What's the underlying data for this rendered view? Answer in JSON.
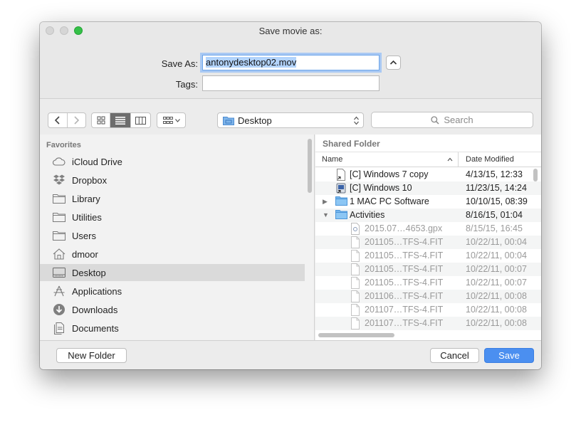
{
  "window": {
    "title": "Save movie as:"
  },
  "form": {
    "save_as_label": "Save As:",
    "save_as_value": "antonydesktop02.mov",
    "tags_label": "Tags:",
    "tags_value": ""
  },
  "toolbar": {
    "location": "Desktop",
    "search_placeholder": "Search",
    "active_view": "list"
  },
  "sidebar": {
    "heading": "Favorites",
    "items": [
      {
        "label": "iCloud Drive",
        "icon": "cloud-icon",
        "selected": false
      },
      {
        "label": "Dropbox",
        "icon": "dropbox-icon",
        "selected": false
      },
      {
        "label": "Library",
        "icon": "folder-icon",
        "selected": false
      },
      {
        "label": "Utilities",
        "icon": "folder-icon",
        "selected": false
      },
      {
        "label": "Users",
        "icon": "folder-icon",
        "selected": false
      },
      {
        "label": "dmoor",
        "icon": "home-icon",
        "selected": false
      },
      {
        "label": "Desktop",
        "icon": "desktop-icon",
        "selected": true
      },
      {
        "label": "Applications",
        "icon": "applications-icon",
        "selected": false
      },
      {
        "label": "Downloads",
        "icon": "downloads-icon",
        "selected": false
      },
      {
        "label": "Documents",
        "icon": "documents-icon",
        "selected": false
      }
    ]
  },
  "browser": {
    "folder_title": "Shared Folder",
    "columns": {
      "name": "Name",
      "date": "Date Modified"
    },
    "rows": [
      {
        "name": "[C] Windows 7 copy",
        "date": "4/13/15, 12:33",
        "icon": "alias-doc-icon",
        "disclosure": "",
        "dim": false,
        "indent": 0
      },
      {
        "name": "[C] Windows 10",
        "date": "11/23/15, 14:24",
        "icon": "alias-app-icon",
        "disclosure": "",
        "dim": false,
        "indent": 0
      },
      {
        "name": "1 MAC PC Software",
        "date": "10/10/15, 08:39",
        "icon": "folder-icon",
        "disclosure": "▶",
        "dim": false,
        "indent": 0
      },
      {
        "name": "Activities",
        "date": "8/16/15, 01:04",
        "icon": "folder-icon",
        "disclosure": "▼",
        "dim": false,
        "indent": 0
      },
      {
        "name": "2015.07…4653.gpx",
        "date": "8/15/15, 16:45",
        "icon": "gpx-file-icon",
        "disclosure": "",
        "dim": true,
        "indent": 1
      },
      {
        "name": "201105…TFS-4.FIT",
        "date": "10/22/11, 00:04",
        "icon": "document-icon",
        "disclosure": "",
        "dim": true,
        "indent": 1
      },
      {
        "name": "201105…TFS-4.FIT",
        "date": "10/22/11, 00:04",
        "icon": "document-icon",
        "disclosure": "",
        "dim": true,
        "indent": 1
      },
      {
        "name": "201105…TFS-4.FIT",
        "date": "10/22/11, 00:07",
        "icon": "document-icon",
        "disclosure": "",
        "dim": true,
        "indent": 1
      },
      {
        "name": "201105…TFS-4.FIT",
        "date": "10/22/11, 00:07",
        "icon": "document-icon",
        "disclosure": "",
        "dim": true,
        "indent": 1
      },
      {
        "name": "201106…TFS-4.FIT",
        "date": "10/22/11, 00:08",
        "icon": "document-icon",
        "disclosure": "",
        "dim": true,
        "indent": 1
      },
      {
        "name": "201107…TFS-4.FIT",
        "date": "10/22/11, 00:08",
        "icon": "document-icon",
        "disclosure": "",
        "dim": true,
        "indent": 1
      },
      {
        "name": "201107…TFS-4.FIT",
        "date": "10/22/11, 00:08",
        "icon": "document-icon",
        "disclosure": "",
        "dim": true,
        "indent": 1
      }
    ]
  },
  "buttons": {
    "new_folder": "New Folder",
    "cancel": "Cancel",
    "save": "Save"
  },
  "colors": {
    "accent": "#4b8ff0",
    "selection": "#b3d4fc",
    "zoom_button": "#35c048"
  }
}
